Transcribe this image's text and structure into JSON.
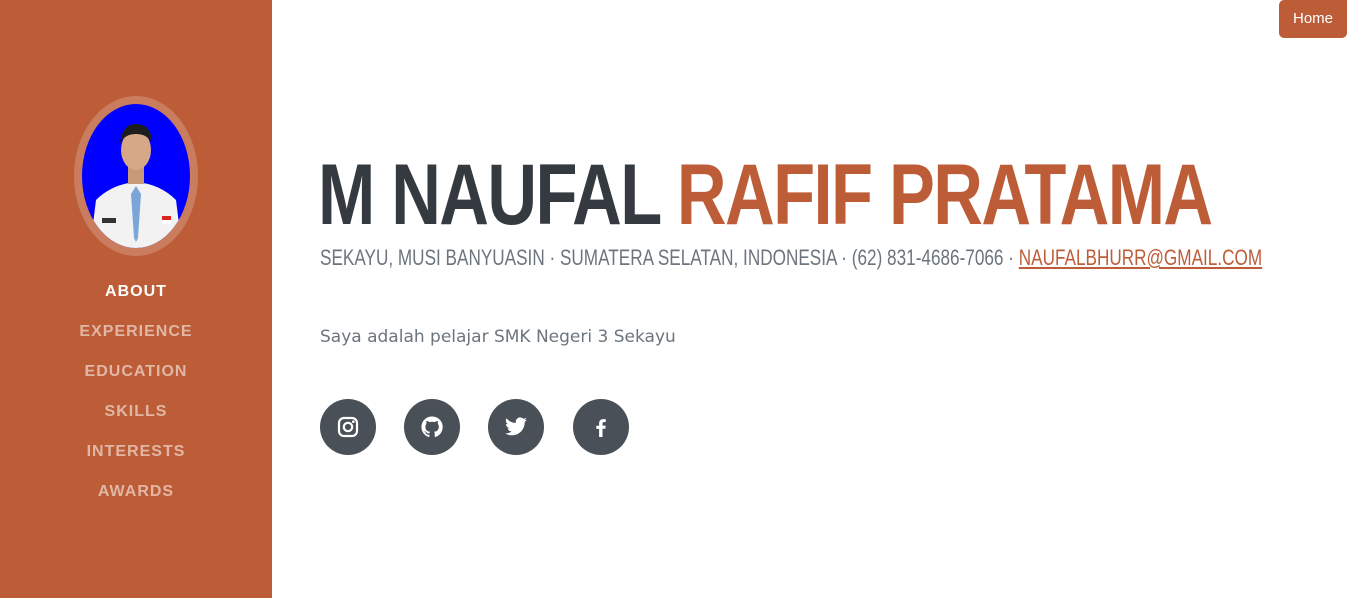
{
  "header": {
    "home_label": "Home"
  },
  "sidebar": {
    "nav": [
      {
        "label": "About",
        "active": true
      },
      {
        "label": "Experience"
      },
      {
        "label": "Education"
      },
      {
        "label": "Skills"
      },
      {
        "label": "Interests"
      },
      {
        "label": "Awards"
      }
    ]
  },
  "profile": {
    "first_name": "M Naufal",
    "last_name": "Rafif Pratama",
    "location": "Sekayu, Musi Banyuasin · Sumatera Selatan, Indonesia",
    "separator": "·",
    "phone": "(62) 831-4686-7066",
    "email": "naufalbhurr@gmail.com",
    "about": "Saya adalah pelajar SMK Negeri 3 Sekayu"
  },
  "social": [
    "instagram-icon",
    "github-icon",
    "twitter-icon",
    "facebook-icon"
  ],
  "colors": {
    "primary": "#bd5d38",
    "heading": "#343a40",
    "muted": "#6c757d",
    "social_bg": "#495057"
  }
}
